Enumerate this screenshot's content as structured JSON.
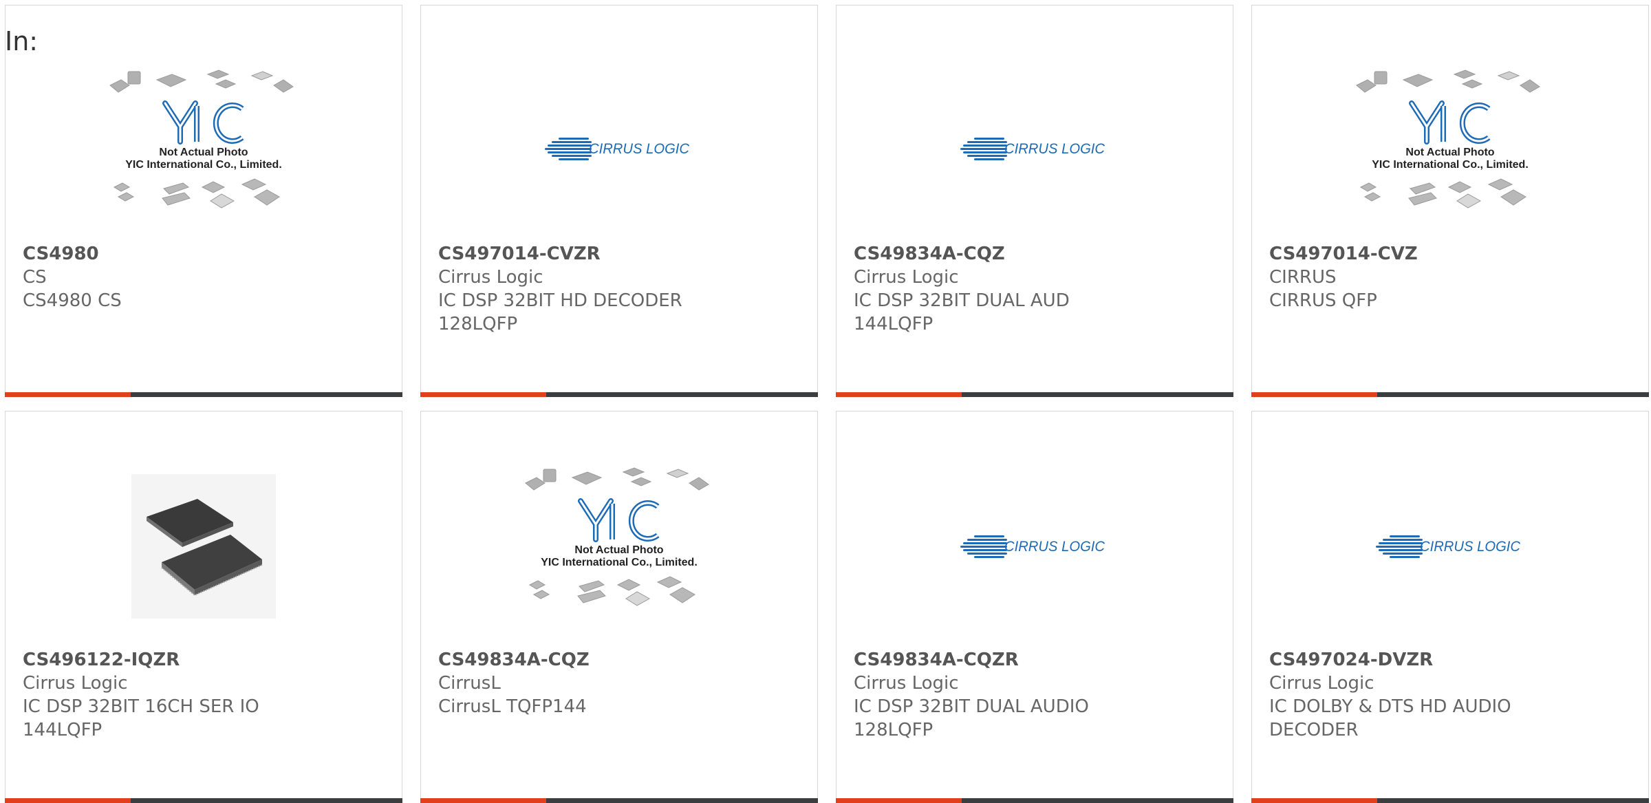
{
  "page": {
    "label": "In:"
  },
  "placeholder": {
    "line1": "Not Actual Photo",
    "line2": "YIC International Co., Limited."
  },
  "brand_logo": {
    "text": "CIRRUS LOGIC"
  },
  "colors": {
    "accent": "#e2401c",
    "bar": "#3b3d3f",
    "border": "#d7d7d7",
    "logo_blue": "#1d6bb6"
  },
  "products": [
    {
      "part": "CS4980",
      "manufacturer": "CS",
      "desc1": "CS4980 CS",
      "desc2": "",
      "image": "placeholder-yic"
    },
    {
      "part": "CS497014-CVZR",
      "manufacturer": "Cirrus Logic",
      "desc1": "IC DSP 32BIT HD DECODER",
      "desc2": "128LQFP",
      "image": "cirrus-logo"
    },
    {
      "part": "CS49834A-CQZ",
      "manufacturer": "Cirrus Logic",
      "desc1": "IC DSP 32BIT DUAL AUD",
      "desc2": "144LQFP",
      "image": "cirrus-logo"
    },
    {
      "part": "CS497014-CVZ",
      "manufacturer": "CIRRUS",
      "desc1": "CIRRUS QFP",
      "desc2": "",
      "image": "placeholder-yic"
    },
    {
      "part": "CS496122-IQZR",
      "manufacturer": "Cirrus Logic",
      "desc1": "IC DSP 32BIT 16CH SER IO",
      "desc2": "144LQFP",
      "image": "chip-photo"
    },
    {
      "part": "CS49834A-CQZ",
      "manufacturer": "CirrusL",
      "desc1": "CirrusL TQFP144",
      "desc2": "",
      "image": "placeholder-yic"
    },
    {
      "part": "CS49834A-CQZR",
      "manufacturer": "Cirrus Logic",
      "desc1": "IC DSP 32BIT DUAL AUDIO",
      "desc2": "128LQFP",
      "image": "cirrus-logo"
    },
    {
      "part": "CS497024-DVZR",
      "manufacturer": "Cirrus Logic",
      "desc1": "IC DOLBY & DTS HD AUDIO",
      "desc2": "DECODER",
      "image": "cirrus-logo"
    }
  ]
}
